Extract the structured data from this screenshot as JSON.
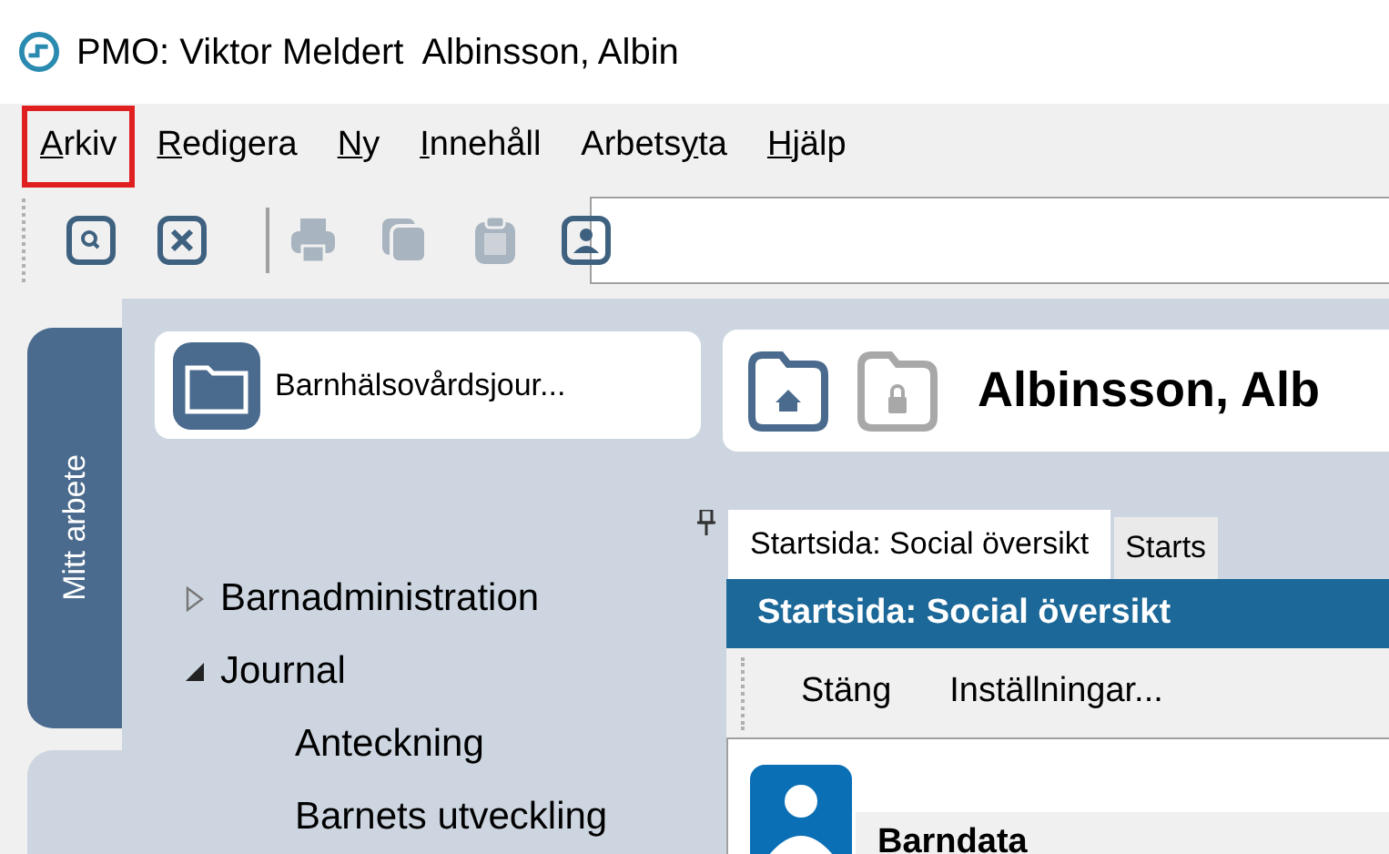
{
  "window": {
    "title": "PMO: Viktor Meldert  Albinsson, Albin"
  },
  "menu": [
    {
      "mnemonic": "A",
      "after": "rkiv",
      "highlighted": true
    },
    {
      "mnemonic": "R",
      "after": "edigera",
      "highlighted": false
    },
    {
      "mnemonic": "N",
      "after": "y",
      "highlighted": false
    },
    {
      "mnemonic": "I",
      "after": "nnehåll",
      "highlighted": false
    },
    {
      "before": "Arbets",
      "mnemonic": "y",
      "after": "ta",
      "highlighted": false
    },
    {
      "mnemonic": "H",
      "after": "jälp",
      "highlighted": false
    }
  ],
  "toolbar": [
    {
      "kind": "search",
      "disabled": false
    },
    {
      "kind": "close",
      "disabled": false
    },
    {
      "kind": "separator"
    },
    {
      "kind": "print",
      "disabled": true
    },
    {
      "kind": "copy",
      "disabled": true
    },
    {
      "kind": "paste",
      "disabled": true
    },
    {
      "kind": "person",
      "disabled": false
    }
  ],
  "side_tabs": [
    {
      "label": "Mitt arbete",
      "selected": true
    },
    {
      "selected": false
    }
  ],
  "journal_card": {
    "label": "Barnhälsovårdsjour..."
  },
  "nav_tree": [
    {
      "label": "Barnadministration",
      "expanded": false
    },
    {
      "label": "Journal",
      "expanded": true,
      "children": [
        {
          "label": "Anteckning"
        },
        {
          "label": "Barnets utveckling"
        }
      ]
    }
  ],
  "record_header": {
    "buttons": [
      {
        "kind": "home",
        "disabled": false
      },
      {
        "kind": "lock",
        "disabled": true
      }
    ],
    "patient_name": "Albinsson, Alb"
  },
  "tabs": [
    {
      "label": "Startsida: Social översikt",
      "selected": true
    },
    {
      "label": "Starts",
      "selected": false
    }
  ],
  "panel": {
    "title": "Startsida: Social översikt",
    "actions": [
      "Stäng",
      "Inställningar..."
    ],
    "section_title": "Barndata"
  }
}
